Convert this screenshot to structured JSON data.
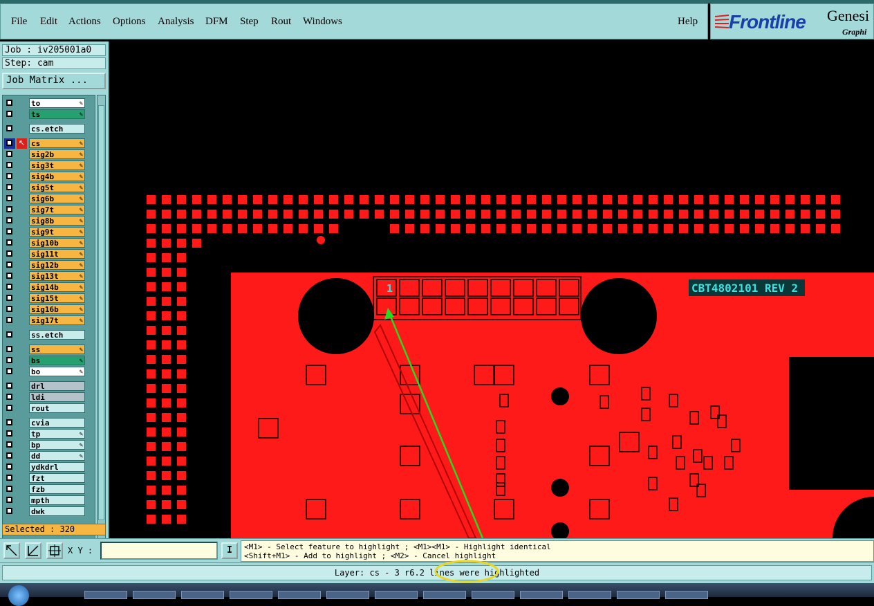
{
  "menubar": {
    "items": [
      "File",
      "Edit",
      "Actions",
      "Options",
      "Analysis",
      "DFM",
      "Step",
      "Rout",
      "Windows"
    ],
    "help": "Help"
  },
  "brand": {
    "logo": "Frontline",
    "product": "Genesi",
    "subtitle": "Graphi"
  },
  "job": {
    "job_label": "Job : iv205001a0",
    "step_label": "Step: cam",
    "matrix_button": "Job Matrix ..."
  },
  "layers": [
    {
      "name": "to",
      "color": "#ffffff",
      "mark": "edit"
    },
    {
      "name": "ts",
      "color": "#26a06f",
      "mark": "edit"
    },
    {
      "name": "cs.etch",
      "color": "#c8ecec",
      "mark": ""
    },
    {
      "name": "cs",
      "color": "#f7b642",
      "mark": "edit",
      "active": true
    },
    {
      "name": "sig2b",
      "color": "#f7b642",
      "mark": "edit"
    },
    {
      "name": "sig3t",
      "color": "#f7b642",
      "mark": "edit"
    },
    {
      "name": "sig4b",
      "color": "#f7b642",
      "mark": "edit"
    },
    {
      "name": "sig5t",
      "color": "#f7b642",
      "mark": "edit"
    },
    {
      "name": "sig6b",
      "color": "#f7b642",
      "mark": "edit"
    },
    {
      "name": "sig7t",
      "color": "#f7b642",
      "mark": "edit"
    },
    {
      "name": "sig8b",
      "color": "#f7b642",
      "mark": "edit"
    },
    {
      "name": "sig9t",
      "color": "#f7b642",
      "mark": "edit"
    },
    {
      "name": "sig10b",
      "color": "#f7b642",
      "mark": "edit"
    },
    {
      "name": "sig11t",
      "color": "#f7b642",
      "mark": "edit"
    },
    {
      "name": "sig12b",
      "color": "#f7b642",
      "mark": "edit"
    },
    {
      "name": "sig13t",
      "color": "#f7b642",
      "mark": "edit"
    },
    {
      "name": "sig14b",
      "color": "#f7b642",
      "mark": "edit"
    },
    {
      "name": "sig15t",
      "color": "#f7b642",
      "mark": "edit"
    },
    {
      "name": "sig16b",
      "color": "#f7b642",
      "mark": "edit"
    },
    {
      "name": "sig17t",
      "color": "#f7b642",
      "mark": "edit"
    },
    {
      "name": "ss.etch",
      "color": "#c8ecec",
      "mark": ""
    },
    {
      "name": "ss",
      "color": "#f7b642",
      "mark": "edit"
    },
    {
      "name": "bs",
      "color": "#26a06f",
      "mark": "edit"
    },
    {
      "name": "bo",
      "color": "#ffffff",
      "mark": "edit"
    },
    {
      "name": "drl",
      "color": "#b4c3c9",
      "mark": ""
    },
    {
      "name": "ldi",
      "color": "#b4c3c9",
      "mark": ""
    },
    {
      "name": "rout",
      "color": "#c8ecec",
      "mark": ""
    },
    {
      "name": "cvia",
      "color": "#c8ecec",
      "mark": ""
    },
    {
      "name": "tp",
      "color": "#c8ecec",
      "mark": "edit"
    },
    {
      "name": "bp",
      "color": "#c8ecec",
      "mark": "edit"
    },
    {
      "name": "dd",
      "color": "#c8ecec",
      "mark": "edit"
    },
    {
      "name": "ydkdrl",
      "color": "#c8ecec",
      "mark": ""
    },
    {
      "name": "fzt",
      "color": "#c8ecec",
      "mark": ""
    },
    {
      "name": "fzb",
      "color": "#c8ecec",
      "mark": ""
    },
    {
      "name": "mpth",
      "color": "#c8ecec",
      "mark": ""
    },
    {
      "name": "dwk",
      "color": "#c8ecec",
      "mark": ""
    }
  ],
  "selected": "Selected : 320",
  "coords": {
    "label": "X Y :",
    "value": ""
  },
  "info_button": "I",
  "hints": {
    "line1": "<M1> - Select feature to highlight ; <M1><M1> - Highlight identical",
    "line2": "<Shift+M1> - Add to highlight ; <M2> - Cancel highlight"
  },
  "status": "Layer: cs - 3 r6.2 lines were highlighted",
  "board": {
    "silkscreen": "CBT4802101 REV 2",
    "pin1_label": "1",
    "copper_color": "#ff1a1a",
    "annotation_arrow_color": "#22dd22",
    "annotation_circle_color": "#e6d829"
  },
  "colors": {
    "panel": "#a3d9d8",
    "active_layer": "#f7b642",
    "logo": "#1b3fa6"
  }
}
